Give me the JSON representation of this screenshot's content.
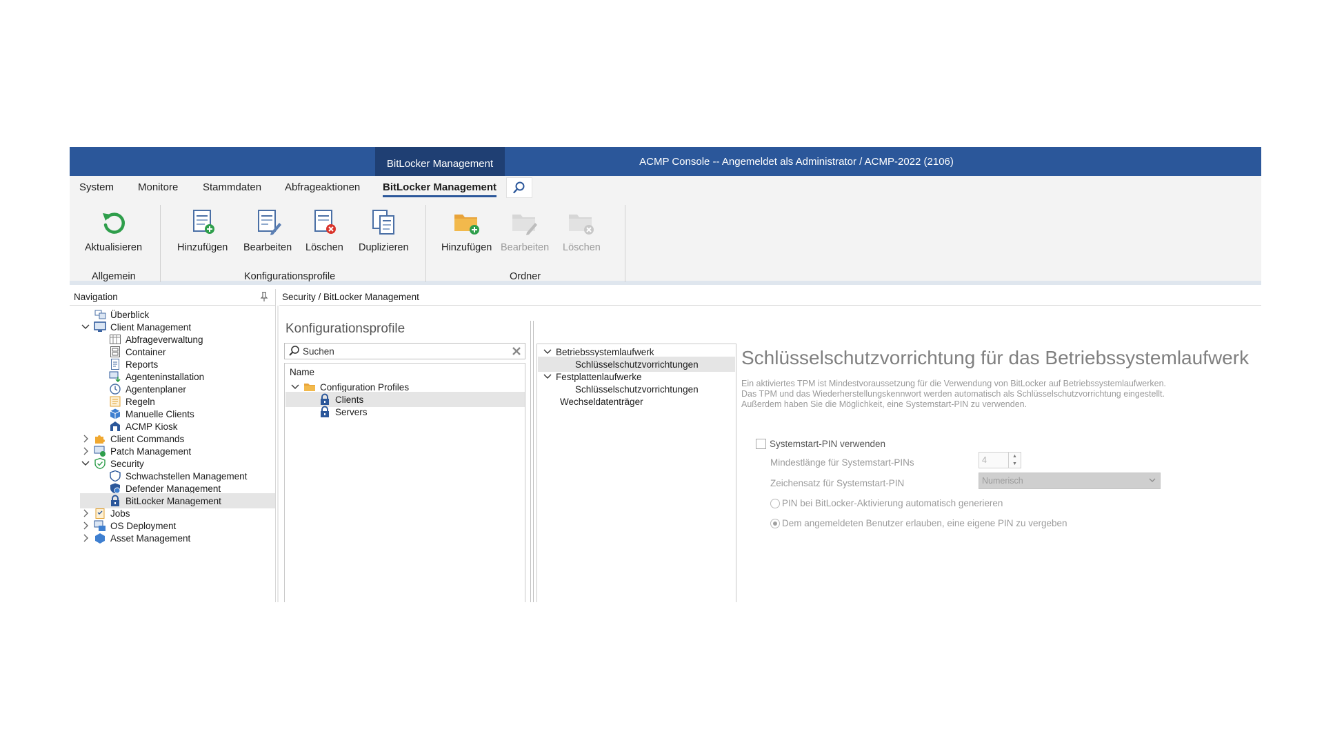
{
  "titlebar": {
    "context_tab": "BitLocker Management",
    "app_title": "ACMP Console -- Angemeldet als Administrator / ACMP-2022 (2106)"
  },
  "menu": {
    "tabs": [
      "System",
      "Monitore",
      "Stammdaten",
      "Abfrageaktionen",
      "BitLocker Management"
    ],
    "active": "BitLocker Management"
  },
  "ribbon": {
    "allgemein": {
      "refresh": "Aktualisieren",
      "label": "Allgemein"
    },
    "profiles": {
      "add": "Hinzufügen",
      "edit": "Bearbeiten",
      "delete": "Löschen",
      "duplicate": "Duplizieren",
      "label": "Konfigurationsprofile"
    },
    "folder": {
      "add": "Hinzufügen",
      "edit": "Bearbeiten",
      "delete": "Löschen",
      "label": "Ordner"
    }
  },
  "navigation": {
    "header": "Navigation",
    "items": [
      {
        "label": "Überblick",
        "level": 0,
        "icon": "overview-icon"
      },
      {
        "label": "Client Management",
        "level": 0,
        "icon": "monitor-icon",
        "expanded": true
      },
      {
        "label": "Abfrageverwaltung",
        "level": 1,
        "icon": "table-icon"
      },
      {
        "label": "Container",
        "level": 1,
        "icon": "container-icon"
      },
      {
        "label": "Reports",
        "level": 1,
        "icon": "reports-icon"
      },
      {
        "label": "Agenteninstallation",
        "level": 1,
        "icon": "agent-install-icon"
      },
      {
        "label": "Agentenplaner",
        "level": 1,
        "icon": "clock-icon"
      },
      {
        "label": "Regeln",
        "level": 1,
        "icon": "rules-icon"
      },
      {
        "label": "Manuelle Clients",
        "level": 1,
        "icon": "cube-icon"
      },
      {
        "label": "ACMP Kiosk",
        "level": 1,
        "icon": "kiosk-icon"
      },
      {
        "label": "Client Commands",
        "level": 0,
        "icon": "puzzle-icon",
        "collapsed": true
      },
      {
        "label": "Patch Management",
        "level": 0,
        "icon": "patch-icon",
        "collapsed": true
      },
      {
        "label": "Security",
        "level": 0,
        "icon": "shield-icon",
        "expanded": true
      },
      {
        "label": "Schwachstellen Management",
        "level": 1,
        "icon": "shield-outline-icon"
      },
      {
        "label": "Defender Management",
        "level": 1,
        "icon": "defender-icon"
      },
      {
        "label": "BitLocker Management",
        "level": 1,
        "icon": "lock-icon",
        "selected": true
      },
      {
        "label": "Jobs",
        "level": 0,
        "icon": "jobs-icon",
        "collapsed": true
      },
      {
        "label": "OS Deployment",
        "level": 0,
        "icon": "deployment-icon",
        "collapsed": true
      },
      {
        "label": "Asset Management",
        "level": 0,
        "icon": "asset-icon",
        "collapsed": true
      }
    ]
  },
  "breadcrumb": "Security / BitLocker Management",
  "profiles": {
    "title": "Konfigurationsprofile",
    "search_placeholder": "Suchen",
    "column": "Name",
    "root": "Configuration Profiles",
    "items": [
      "Clients",
      "Servers"
    ],
    "selected": "Clients"
  },
  "sections": {
    "groups": [
      {
        "label": "Betriebssystemlaufwerk",
        "child": "Schlüsselschutzvorrichtungen",
        "selected": true
      },
      {
        "label": "Festplattenlaufwerke",
        "child": "Schlüsselschutzvorrichtungen"
      },
      {
        "label": "Wechseldatenträger"
      }
    ]
  },
  "detail": {
    "title": "Schlüsselschutzvorrichtung für das Betriebssystemlaufwerk",
    "description": "Ein aktiviertes TPM ist Mindestvoraussetzung für die Verwendung von BitLocker auf Betriebssystemlaufwerken. Das TPM und das Wiederherstellungskennwort werden automatisch als Schlüsselschutzvorrichtung eingestellt. Außerdem haben Sie die Möglichkeit, eine Systemstart-PIN zu verwenden.",
    "checkbox_label": "Systemstart-PIN verwenden",
    "min_length_label": "Mindestlänge für Systemstart-PINs",
    "min_length_value": "4",
    "charset_label": "Zeichensatz für Systemstart-PIN",
    "charset_value": "Numerisch",
    "radio_auto": "PIN bei BitLocker-Aktivierung automatisch generieren",
    "radio_user": "Dem angemeldeten Benutzer erlauben, eine eigene PIN zu vergeben"
  },
  "colors": {
    "titlebar": "#2b579a",
    "context_tab": "#1f3f73",
    "selection": "#e5e5e5"
  }
}
